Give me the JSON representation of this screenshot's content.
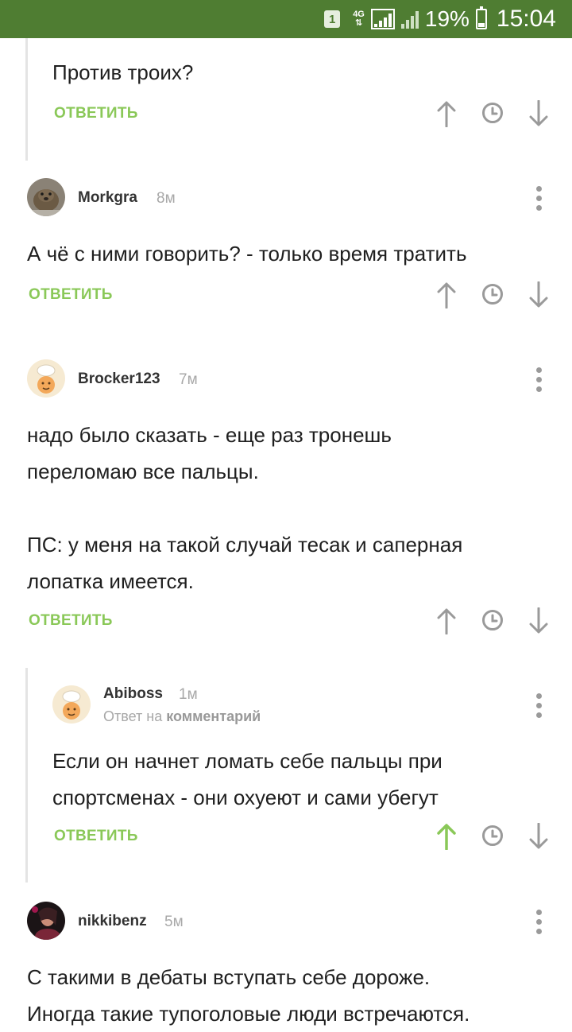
{
  "status_bar": {
    "sim_badge": "1",
    "network": "4G",
    "battery_percent": "19%",
    "battery_level": 0.19,
    "time": "15:04",
    "bar_color": "#4f7d32"
  },
  "labels": {
    "reply": "ОТВЕТИТЬ",
    "reply_to_prefix": "Ответ на",
    "reply_to_link": "комментарий"
  },
  "colors": {
    "accent_green": "#8ac858",
    "icon_gray": "#9a9a9a"
  },
  "comments": [
    {
      "author": "",
      "age": "",
      "text": "Против троих?",
      "upvoted": false,
      "icons": [
        "upvote-arrow-icon",
        "clock-icon",
        "downvote-arrow-icon"
      ]
    },
    {
      "author": "Morkgra",
      "age": "8м",
      "text": "А чё с ними говорить? - только время тратить",
      "upvoted": false,
      "icons": [
        "avatar-beaver",
        "more-vert-icon"
      ]
    },
    {
      "author": "Brocker123",
      "age": "7м",
      "text_lines": [
        "надо было сказать - еще раз тронешь",
        "переломаю все пальцы.",
        "",
        "ПС: у меня на такой случай тесак и саперная",
        "лопатка имеется."
      ],
      "upvoted": false,
      "icons": [
        "avatar-chef",
        "more-vert-icon"
      ]
    },
    {
      "author": "Abiboss",
      "age": "1м",
      "reply_to": true,
      "text_lines": [
        "Если он начнет ломать себе пальцы при",
        "спортсменах - они охуеют и сами убегут"
      ],
      "upvoted": true,
      "icons": [
        "avatar-chef",
        "more-vert-icon"
      ]
    },
    {
      "author": "nikkibenz",
      "age": "5м",
      "text_lines": [
        "С такими в дебаты вступать себе дороже.",
        "Иногда такие тупоголовые люди встречаются."
      ],
      "icons": [
        "avatar-photo",
        "more-vert-icon"
      ]
    }
  ]
}
